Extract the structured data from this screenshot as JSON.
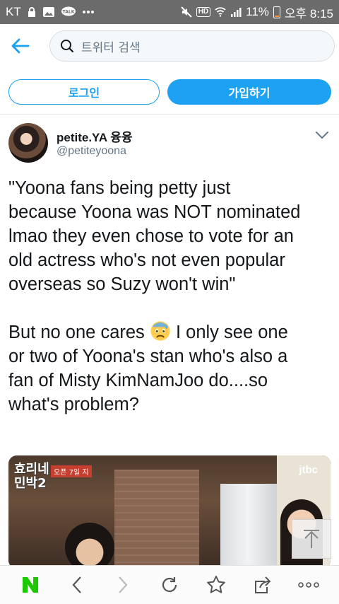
{
  "status_bar": {
    "carrier": "KT",
    "network_badge": "HD",
    "battery_percent": "11%",
    "time": "오후 8:15",
    "icons": [
      "lock-icon",
      "image-icon",
      "talk-icon",
      "more-dots",
      "mute-icon",
      "wifi-icon",
      "signal-icon",
      "battery-icon"
    ]
  },
  "search": {
    "placeholder": "트위터 검색"
  },
  "auth": {
    "login_label": "로그인",
    "signup_label": "가입하기"
  },
  "tweet": {
    "display_name": "petite.YA 융융",
    "username": "@petiteyoona",
    "quote_lines": [
      "\"Yoona fans being petty just",
      "because Yoona was NOT nominated",
      "lmao they even chose to vote for an",
      "old actress who's not even popular",
      "overseas so Suzy won't win\""
    ],
    "body_line1_before": "But no one cares ",
    "body_line1_after": " I only see one",
    "body_lines": [
      "or two of Yoona's stan who's also a",
      "fan of Misty KimNamJoo do....so",
      "what's problem?"
    ],
    "emoji": "anxious-face-with-sweat",
    "media": {
      "show_logo_line1": "효리네",
      "show_logo_line2": "민박2",
      "airtime": "오픈 7일 지",
      "broadcaster": "jtbc"
    }
  },
  "colors": {
    "accent": "#1da1f2",
    "naver_green": "#1ec800",
    "status_bar_bg": "#6b6b6b"
  }
}
